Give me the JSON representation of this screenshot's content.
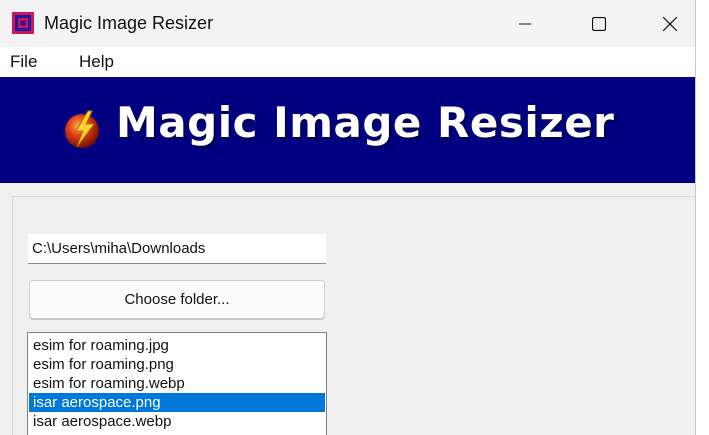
{
  "window": {
    "title": "Magic Image Resizer",
    "buttons": {
      "minimize": "minimize-icon",
      "maximize": "maximize-icon",
      "close": "close-icon"
    }
  },
  "menu": {
    "items": [
      {
        "label": "File"
      },
      {
        "label": "Help"
      }
    ]
  },
  "banner": {
    "title": "Magic Image Resizer",
    "logo_icon": "lightning-orb-icon"
  },
  "folder": {
    "path": "C:\\Users\\miha\\Downloads",
    "choose_label": "Choose folder..."
  },
  "files": {
    "items": [
      {
        "name": "esim for roaming.jpg",
        "selected": false
      },
      {
        "name": "esim for roaming.png",
        "selected": false
      },
      {
        "name": "esim for roaming.webp",
        "selected": false
      },
      {
        "name": "isar aerospace.png",
        "selected": true
      },
      {
        "name": "isar aerospace.webp",
        "selected": false
      }
    ]
  },
  "colors": {
    "banner_bg": "#000080",
    "selection": "#0078d7"
  }
}
